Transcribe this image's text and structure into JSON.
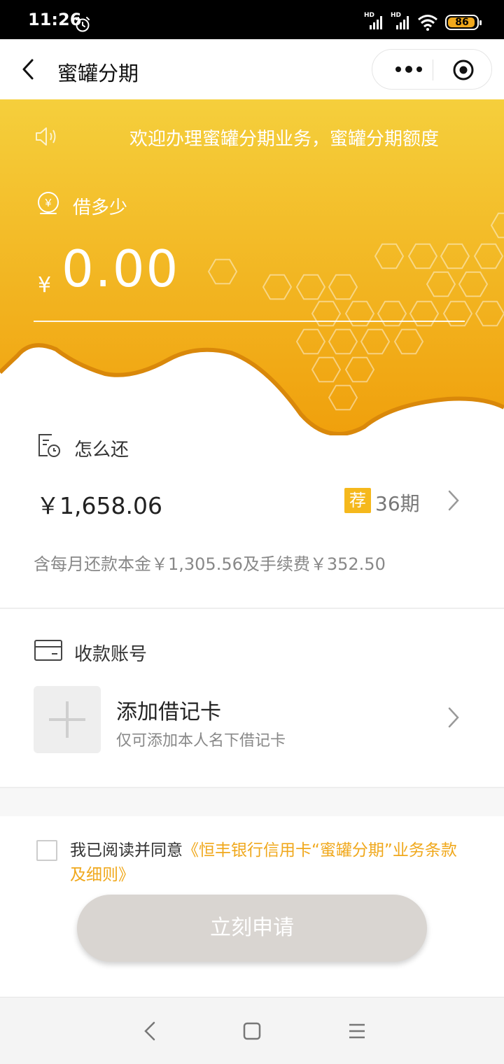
{
  "status_bar": {
    "time": "11:26",
    "battery": "86"
  },
  "nav": {
    "title": "蜜罐分期"
  },
  "hero": {
    "notice": "欢迎办理蜜罐分期业务，蜜罐分期额度",
    "borrow_label": "借多少",
    "currency": "¥",
    "amount": "0.00"
  },
  "repayment": {
    "label": "怎么还",
    "amount": "￥1,658.06",
    "badge": "荐",
    "period": "36期",
    "detail": "含每月还款本金￥1,305.56及手续费￥352.50"
  },
  "account": {
    "label": "收款账号",
    "add_title": "添加借记卡",
    "add_subtitle": "仅可添加本人名下借记卡"
  },
  "agreement": {
    "prefix": "我已阅读并同意",
    "link": "《恒丰银行信用卡“蜜罐分期”业务条款及细则》"
  },
  "apply_button": "立刻申请",
  "colors": {
    "accent": "#f0a81c",
    "hero_top": "#f5cc3a",
    "hero_bottom": "#f0a00c"
  }
}
